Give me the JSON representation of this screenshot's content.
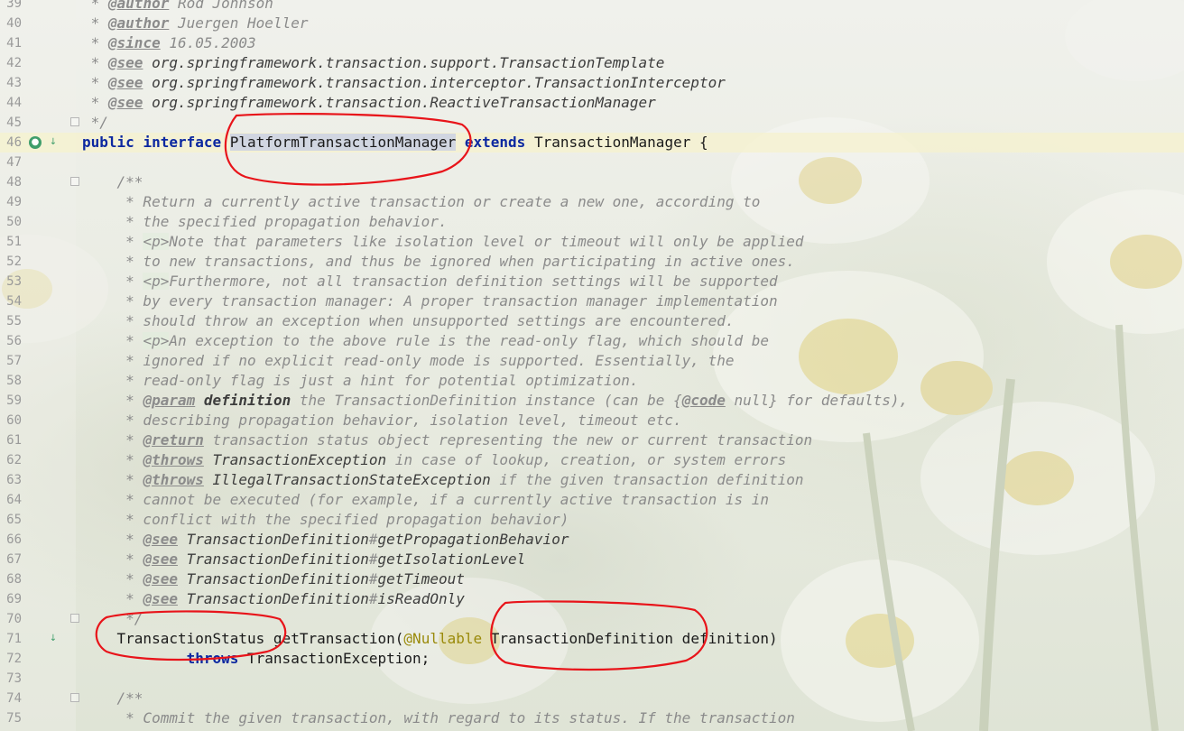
{
  "editor": {
    "lines": [
      {
        "n": "39",
        "parts": [
          {
            "c": "doc",
            "t": " * "
          },
          {
            "c": "tag",
            "t": "@author"
          },
          {
            "c": "doc",
            "t": " Rod Johnson"
          }
        ]
      },
      {
        "n": "40",
        "parts": [
          {
            "c": "doc",
            "t": " * "
          },
          {
            "c": "tag",
            "t": "@author"
          },
          {
            "c": "doc",
            "t": " Juergen Hoeller"
          }
        ]
      },
      {
        "n": "41",
        "parts": [
          {
            "c": "doc",
            "t": " * "
          },
          {
            "c": "tag",
            "t": "@since"
          },
          {
            "c": "doc",
            "t": " 16.05.2003"
          }
        ]
      },
      {
        "n": "42",
        "parts": [
          {
            "c": "doc",
            "t": " * "
          },
          {
            "c": "tag",
            "t": "@see"
          },
          {
            "c": "ref",
            "t": " org.springframework.transaction.support.TransactionTemplate"
          }
        ]
      },
      {
        "n": "43",
        "parts": [
          {
            "c": "doc",
            "t": " * "
          },
          {
            "c": "tag",
            "t": "@see"
          },
          {
            "c": "ref",
            "t": " org.springframework.transaction.interceptor.TransactionInterceptor"
          }
        ]
      },
      {
        "n": "44",
        "parts": [
          {
            "c": "doc",
            "t": " * "
          },
          {
            "c": "tag",
            "t": "@see"
          },
          {
            "c": "ref",
            "t": " org.springframework.transaction.ReactiveTransactionManager"
          }
        ]
      },
      {
        "n": "45",
        "parts": [
          {
            "c": "doc",
            "t": " */"
          }
        ]
      },
      {
        "n": "46",
        "current": true,
        "parts": [
          {
            "c": "kw",
            "t": "public"
          },
          {
            "c": "ident",
            "t": " "
          },
          {
            "c": "kw",
            "t": "interface"
          },
          {
            "c": "ident",
            "t": " "
          },
          {
            "c": "ident sel",
            "t": "PlatformTransactionManager"
          },
          {
            "c": "ident",
            "t": " "
          },
          {
            "c": "kw",
            "t": "extends"
          },
          {
            "c": "ident",
            "t": " TransactionManager {"
          }
        ]
      },
      {
        "n": "47",
        "parts": []
      },
      {
        "n": "48",
        "parts": [
          {
            "c": "doc",
            "t": "    /**"
          }
        ]
      },
      {
        "n": "49",
        "parts": [
          {
            "c": "doc",
            "t": "     * Return a currently active transaction or create a new one, according to"
          }
        ]
      },
      {
        "n": "50",
        "parts": [
          {
            "c": "doc",
            "t": "     * the specified propagation behavior."
          }
        ]
      },
      {
        "n": "51",
        "parts": [
          {
            "c": "doc",
            "t": "     * "
          },
          {
            "c": "html-tag",
            "t": "<p>"
          },
          {
            "c": "doc",
            "t": "Note that parameters like isolation level or timeout will only be applied"
          }
        ]
      },
      {
        "n": "52",
        "parts": [
          {
            "c": "doc",
            "t": "     * to new transactions, and thus be ignored when participating in active ones."
          }
        ]
      },
      {
        "n": "53",
        "parts": [
          {
            "c": "doc",
            "t": "     * "
          },
          {
            "c": "html-tag",
            "t": "<p>"
          },
          {
            "c": "doc",
            "t": "Furthermore, not all transaction definition settings will be supported"
          }
        ]
      },
      {
        "n": "54",
        "parts": [
          {
            "c": "doc",
            "t": "     * by every transaction manager: A proper transaction manager implementation"
          }
        ]
      },
      {
        "n": "55",
        "parts": [
          {
            "c": "doc",
            "t": "     * should throw an exception when unsupported settings are encountered."
          }
        ]
      },
      {
        "n": "56",
        "parts": [
          {
            "c": "doc",
            "t": "     * "
          },
          {
            "c": "html-tag",
            "t": "<p>"
          },
          {
            "c": "doc",
            "t": "An exception to the above rule is the read-only flag, which should be"
          }
        ]
      },
      {
        "n": "57",
        "parts": [
          {
            "c": "doc",
            "t": "     * ignored if no explicit read-only mode is supported. Essentially, the"
          }
        ]
      },
      {
        "n": "58",
        "parts": [
          {
            "c": "doc",
            "t": "     * read-only flag is just a hint for potential optimization."
          }
        ]
      },
      {
        "n": "59",
        "parts": [
          {
            "c": "doc",
            "t": "     * "
          },
          {
            "c": "tag",
            "t": "@param"
          },
          {
            "c": "doc",
            "t": " "
          },
          {
            "c": "pname",
            "t": "definition"
          },
          {
            "c": "doc",
            "t": " the TransactionDefinition instance (can be {"
          },
          {
            "c": "tag",
            "t": "@code"
          },
          {
            "c": "doc",
            "t": " null} for defaults),"
          }
        ]
      },
      {
        "n": "60",
        "parts": [
          {
            "c": "doc",
            "t": "     * describing propagation behavior, isolation level, timeout etc."
          }
        ]
      },
      {
        "n": "61",
        "parts": [
          {
            "c": "doc",
            "t": "     * "
          },
          {
            "c": "tag",
            "t": "@return"
          },
          {
            "c": "doc",
            "t": " transaction status object representing the new or current transaction"
          }
        ]
      },
      {
        "n": "62",
        "parts": [
          {
            "c": "doc",
            "t": "     * "
          },
          {
            "c": "tag",
            "t": "@throws"
          },
          {
            "c": "ref",
            "t": " TransactionException"
          },
          {
            "c": "doc",
            "t": " in case of lookup, creation, or system errors"
          }
        ]
      },
      {
        "n": "63",
        "parts": [
          {
            "c": "doc",
            "t": "     * "
          },
          {
            "c": "tag",
            "t": "@throws"
          },
          {
            "c": "ref",
            "t": " IllegalTransactionStateException"
          },
          {
            "c": "doc",
            "t": " if the given transaction definition"
          }
        ]
      },
      {
        "n": "64",
        "parts": [
          {
            "c": "doc",
            "t": "     * cannot be executed (for example, if a currently active transaction is in"
          }
        ]
      },
      {
        "n": "65",
        "parts": [
          {
            "c": "doc",
            "t": "     * conflict with the specified propagation behavior)"
          }
        ]
      },
      {
        "n": "66",
        "parts": [
          {
            "c": "doc",
            "t": "     * "
          },
          {
            "c": "tag",
            "t": "@see"
          },
          {
            "c": "ref",
            "t": " TransactionDefinition"
          },
          {
            "c": "hash",
            "t": "#"
          },
          {
            "c": "ref",
            "t": "getPropagationBehavior"
          }
        ]
      },
      {
        "n": "67",
        "parts": [
          {
            "c": "doc",
            "t": "     * "
          },
          {
            "c": "tag",
            "t": "@see"
          },
          {
            "c": "ref",
            "t": " TransactionDefinition"
          },
          {
            "c": "hash",
            "t": "#"
          },
          {
            "c": "ref",
            "t": "getIsolationLevel"
          }
        ]
      },
      {
        "n": "68",
        "parts": [
          {
            "c": "doc",
            "t": "     * "
          },
          {
            "c": "tag",
            "t": "@see"
          },
          {
            "c": "ref",
            "t": " TransactionDefinition"
          },
          {
            "c": "hash",
            "t": "#"
          },
          {
            "c": "ref",
            "t": "getTimeout"
          }
        ]
      },
      {
        "n": "69",
        "parts": [
          {
            "c": "doc",
            "t": "     * "
          },
          {
            "c": "tag",
            "t": "@see"
          },
          {
            "c": "ref",
            "t": " TransactionDefinition"
          },
          {
            "c": "hash",
            "t": "#"
          },
          {
            "c": "ref",
            "t": "isReadOnly"
          }
        ]
      },
      {
        "n": "70",
        "parts": [
          {
            "c": "doc",
            "t": "     */"
          }
        ]
      },
      {
        "n": "71",
        "parts": [
          {
            "c": "ident",
            "t": "    TransactionStatus getTransaction("
          },
          {
            "c": "anno",
            "t": "@Nullable"
          },
          {
            "c": "ident",
            "t": " TransactionDefinition definition)"
          }
        ]
      },
      {
        "n": "72",
        "parts": [
          {
            "c": "ident",
            "t": "            "
          },
          {
            "c": "kw",
            "t": "throws"
          },
          {
            "c": "ident",
            "t": " TransactionException;"
          }
        ]
      },
      {
        "n": "73",
        "parts": []
      },
      {
        "n": "74",
        "parts": [
          {
            "c": "doc",
            "t": "    /**"
          }
        ]
      },
      {
        "n": "75",
        "parts": [
          {
            "c": "doc",
            "t": "     * Commit the given transaction, with regard to its status. If the transaction"
          }
        ]
      }
    ]
  },
  "gutter_icons": {
    "line46": [
      "implementations-icon",
      "override-down-icon"
    ],
    "line71": [
      "implemented-down-icon"
    ]
  },
  "colors": {
    "keyword": "#0c28a0",
    "doc_comment": "#8b8b8b",
    "annotation": "#9a8a0a",
    "current_line": "#f5f2cd",
    "red_markup": "#e8141a"
  }
}
